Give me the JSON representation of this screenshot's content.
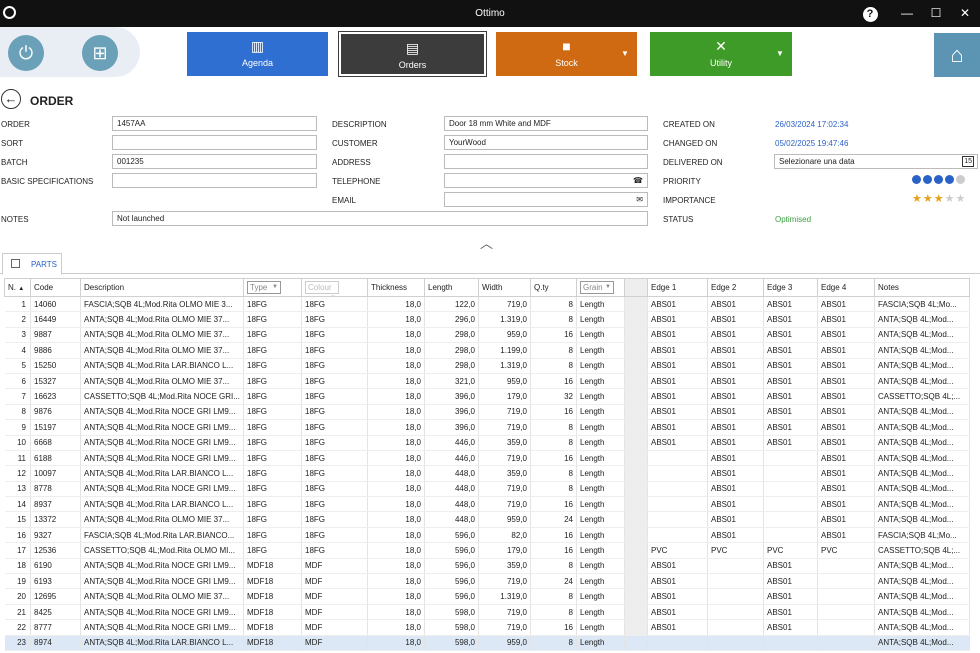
{
  "app": {
    "title": "Ottimo"
  },
  "window_controls": {
    "help": "?",
    "minimize": "—",
    "maximize": "☐",
    "close": "✕"
  },
  "nav": {
    "agenda": "Agenda",
    "orders": "Orders",
    "stock": "Stock",
    "utility": "Utility",
    "colors": {
      "agenda": "#2f6fd1",
      "orders": "#3c3c3c",
      "stock": "#cf6a12",
      "utility": "#3f9b27",
      "home": "#5b95b3"
    }
  },
  "page": {
    "title": "ORDER"
  },
  "form": {
    "order": {
      "label": "ORDER",
      "value": "1457AA"
    },
    "sort": {
      "label": "SORT",
      "value": ""
    },
    "batch": {
      "label": "BATCH",
      "value": "001235"
    },
    "basic_spec": {
      "label": "BASIC SPECIFICATIONS",
      "value": ""
    },
    "notes": {
      "label": "NOTES",
      "value": "Not launched"
    },
    "description": {
      "label": "DESCRIPTION",
      "value": "Door 18 mm White and MDF"
    },
    "customer": {
      "label": "CUSTOMER",
      "value": "YourWood"
    },
    "address": {
      "label": "ADDRESS",
      "value": ""
    },
    "telephone": {
      "label": "TELEPHONE",
      "value": ""
    },
    "email": {
      "label": "EMAIL",
      "value": ""
    },
    "created_on": {
      "label": "CREATED ON",
      "value": "26/03/2024 17:02:34"
    },
    "changed_on": {
      "label": "CHANGED ON",
      "value": "05/02/2025 19:47:46"
    },
    "delivered_on": {
      "label": "DELIVERED ON",
      "value": "Selezionare una data",
      "calendar_day": "15"
    },
    "priority": {
      "label": "PRIORITY",
      "level": 4,
      "max": 5
    },
    "importance": {
      "label": "IMPORTANCE",
      "stars": 3,
      "max": 5
    },
    "status": {
      "label": "STATUS",
      "value": "Optimised"
    }
  },
  "tabs": {
    "parts": "PARTS"
  },
  "table": {
    "headers": {
      "n": "N.",
      "code": "Code",
      "description": "Description",
      "type": "Type",
      "colour": "Colour",
      "thickness": "Thickness",
      "length": "Length",
      "width": "Width",
      "qty": "Q.ty",
      "grain": "Grain",
      "edge1": "Edge 1",
      "edge2": "Edge 2",
      "edge3": "Edge 3",
      "edge4": "Edge 4",
      "notes": "Notes"
    },
    "rows": [
      [
        "1",
        "14060",
        "FASCIA;SQB 4L;Mod.Rita OLMO MIE 3...",
        "18FG",
        "18FG",
        "18,0",
        "122,0",
        "719,0",
        "8",
        "Length",
        "ABS01",
        "ABS01",
        "ABS01",
        "ABS01",
        "FASCIA;SQB 4L;Mo..."
      ],
      [
        "2",
        "16449",
        "ANTA;SQB 4L;Mod.Rita OLMO MIE 37...",
        "18FG",
        "18FG",
        "18,0",
        "296,0",
        "1.319,0",
        "8",
        "Length",
        "ABS01",
        "ABS01",
        "ABS01",
        "ABS01",
        "ANTA;SQB 4L;Mod..."
      ],
      [
        "3",
        "9887",
        "ANTA;SQB 4L;Mod.Rita OLMO MIE 37...",
        "18FG",
        "18FG",
        "18,0",
        "298,0",
        "959,0",
        "16",
        "Length",
        "ABS01",
        "ABS01",
        "ABS01",
        "ABS01",
        "ANTA;SQB 4L;Mod..."
      ],
      [
        "4",
        "9886",
        "ANTA;SQB 4L;Mod.Rita OLMO MIE 37...",
        "18FG",
        "18FG",
        "18,0",
        "298,0",
        "1.199,0",
        "8",
        "Length",
        "ABS01",
        "ABS01",
        "ABS01",
        "ABS01",
        "ANTA;SQB 4L;Mod..."
      ],
      [
        "5",
        "15250",
        "ANTA;SQB 4L;Mod.Rita LAR.BIANCO L...",
        "18FG",
        "18FG",
        "18,0",
        "298,0",
        "1.319,0",
        "8",
        "Length",
        "ABS01",
        "ABS01",
        "ABS01",
        "ABS01",
        "ANTA;SQB 4L;Mod..."
      ],
      [
        "6",
        "15327",
        "ANTA;SQB 4L;Mod.Rita OLMO MIE 37...",
        "18FG",
        "18FG",
        "18,0",
        "321,0",
        "959,0",
        "16",
        "Length",
        "ABS01",
        "ABS01",
        "ABS01",
        "ABS01",
        "ANTA;SQB 4L;Mod..."
      ],
      [
        "7",
        "16623",
        "CASSETTO;SQB 4L;Mod.Rita NOCE GRI...",
        "18FG",
        "18FG",
        "18,0",
        "396,0",
        "179,0",
        "32",
        "Length",
        "ABS01",
        "ABS01",
        "ABS01",
        "ABS01",
        "CASSETTO;SQB 4L;..."
      ],
      [
        "8",
        "9876",
        "ANTA;SQB 4L;Mod.Rita NOCE GRI LM9...",
        "18FG",
        "18FG",
        "18,0",
        "396,0",
        "719,0",
        "16",
        "Length",
        "ABS01",
        "ABS01",
        "ABS01",
        "ABS01",
        "ANTA;SQB 4L;Mod..."
      ],
      [
        "9",
        "15197",
        "ANTA;SQB 4L;Mod.Rita NOCE GRI LM9...",
        "18FG",
        "18FG",
        "18,0",
        "396,0",
        "719,0",
        "8",
        "Length",
        "ABS01",
        "ABS01",
        "ABS01",
        "ABS01",
        "ANTA;SQB 4L;Mod..."
      ],
      [
        "10",
        "6668",
        "ANTA;SQB 4L;Mod.Rita NOCE GRI LM9...",
        "18FG",
        "18FG",
        "18,0",
        "446,0",
        "359,0",
        "8",
        "Length",
        "ABS01",
        "ABS01",
        "ABS01",
        "ABS01",
        "ANTA;SQB 4L;Mod..."
      ],
      [
        "11",
        "6188",
        "ANTA;SQB 4L;Mod.Rita NOCE GRI LM9...",
        "18FG",
        "18FG",
        "18,0",
        "446,0",
        "719,0",
        "16",
        "Length",
        "",
        "ABS01",
        "",
        "ABS01",
        "ANTA;SQB 4L;Mod..."
      ],
      [
        "12",
        "10097",
        "ANTA;SQB 4L;Mod.Rita LAR.BIANCO L...",
        "18FG",
        "18FG",
        "18,0",
        "448,0",
        "359,0",
        "8",
        "Length",
        "",
        "ABS01",
        "",
        "ABS01",
        "ANTA;SQB 4L;Mod..."
      ],
      [
        "13",
        "8778",
        "ANTA;SQB 4L;Mod.Rita NOCE GRI LM9...",
        "18FG",
        "18FG",
        "18,0",
        "448,0",
        "719,0",
        "8",
        "Length",
        "",
        "ABS01",
        "",
        "ABS01",
        "ANTA;SQB 4L;Mod..."
      ],
      [
        "14",
        "8937",
        "ANTA;SQB 4L;Mod.Rita LAR.BIANCO L...",
        "18FG",
        "18FG",
        "18,0",
        "448,0",
        "719,0",
        "16",
        "Length",
        "",
        "ABS01",
        "",
        "ABS01",
        "ANTA;SQB 4L;Mod..."
      ],
      [
        "15",
        "13372",
        "ANTA;SQB 4L;Mod.Rita OLMO MIE 37...",
        "18FG",
        "18FG",
        "18,0",
        "448,0",
        "959,0",
        "24",
        "Length",
        "",
        "ABS01",
        "",
        "ABS01",
        "ANTA;SQB 4L;Mod..."
      ],
      [
        "16",
        "9327",
        "FASCIA;SQB 4L;Mod.Rita LAR.BIANCO...",
        "18FG",
        "18FG",
        "18,0",
        "596,0",
        "82,0",
        "16",
        "Length",
        "",
        "ABS01",
        "",
        "ABS01",
        "FASCIA;SQB 4L;Mo..."
      ],
      [
        "17",
        "12536",
        "CASSETTO;SQB 4L;Mod.Rita OLMO MI...",
        "18FG",
        "18FG",
        "18,0",
        "596,0",
        "179,0",
        "16",
        "Length",
        "PVC",
        "PVC",
        "PVC",
        "PVC",
        "CASSETTO;SQB 4L;..."
      ],
      [
        "18",
        "6190",
        "ANTA;SQB 4L;Mod.Rita NOCE GRI LM9...",
        "MDF18",
        "MDF",
        "18,0",
        "596,0",
        "359,0",
        "8",
        "Length",
        "ABS01",
        "",
        "ABS01",
        "",
        "ANTA;SQB 4L;Mod..."
      ],
      [
        "19",
        "6193",
        "ANTA;SQB 4L;Mod.Rita NOCE GRI LM9...",
        "MDF18",
        "MDF",
        "18,0",
        "596,0",
        "719,0",
        "24",
        "Length",
        "ABS01",
        "",
        "ABS01",
        "",
        "ANTA;SQB 4L;Mod..."
      ],
      [
        "20",
        "12695",
        "ANTA;SQB 4L;Mod.Rita OLMO MIE 37...",
        "MDF18",
        "MDF",
        "18,0",
        "596,0",
        "1.319,0",
        "8",
        "Length",
        "ABS01",
        "",
        "ABS01",
        "",
        "ANTA;SQB 4L;Mod..."
      ],
      [
        "21",
        "8425",
        "ANTA;SQB 4L;Mod.Rita NOCE GRI LM9...",
        "MDF18",
        "MDF",
        "18,0",
        "598,0",
        "719,0",
        "8",
        "Length",
        "ABS01",
        "",
        "ABS01",
        "",
        "ANTA;SQB 4L;Mod..."
      ],
      [
        "22",
        "8777",
        "ANTA;SQB 4L;Mod.Rita NOCE GRI LM9...",
        "MDF18",
        "MDF",
        "18,0",
        "598,0",
        "719,0",
        "16",
        "Length",
        "ABS01",
        "",
        "ABS01",
        "",
        "ANTA;SQB 4L;Mod..."
      ],
      [
        "23",
        "8974",
        "ANTA;SQB 4L;Mod.Rita LAR.BIANCO L...",
        "MDF18",
        "MDF",
        "18,0",
        "598,0",
        "959,0",
        "8",
        "Length",
        "",
        "",
        "",
        "",
        "ANTA;SQB 4L;Mod..."
      ]
    ],
    "selected_row": 23
  }
}
